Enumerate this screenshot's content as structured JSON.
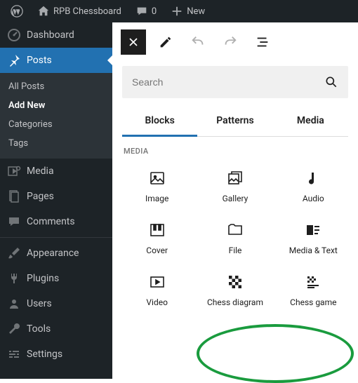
{
  "adminbar": {
    "site_title": "RPB Chessboard",
    "comments_count": "0",
    "new_label": "New"
  },
  "sidebar": {
    "dashboard": "Dashboard",
    "posts": "Posts",
    "posts_sub": {
      "all": "All Posts",
      "add_new": "Add New",
      "categories": "Categories",
      "tags": "Tags"
    },
    "media": "Media",
    "pages": "Pages",
    "comments": "Comments",
    "appearance": "Appearance",
    "plugins": "Plugins",
    "users": "Users",
    "tools": "Tools",
    "settings": "Settings"
  },
  "editor": {
    "search_placeholder": "Search",
    "tabs": {
      "blocks": "Blocks",
      "patterns": "Patterns",
      "media": "Media"
    },
    "section": "MEDIA",
    "blocks": {
      "image": "Image",
      "gallery": "Gallery",
      "audio": "Audio",
      "cover": "Cover",
      "file": "File",
      "media_text": "Media & Text",
      "video": "Video",
      "chess_diagram": "Chess diagram",
      "chess_game": "Chess game"
    }
  }
}
